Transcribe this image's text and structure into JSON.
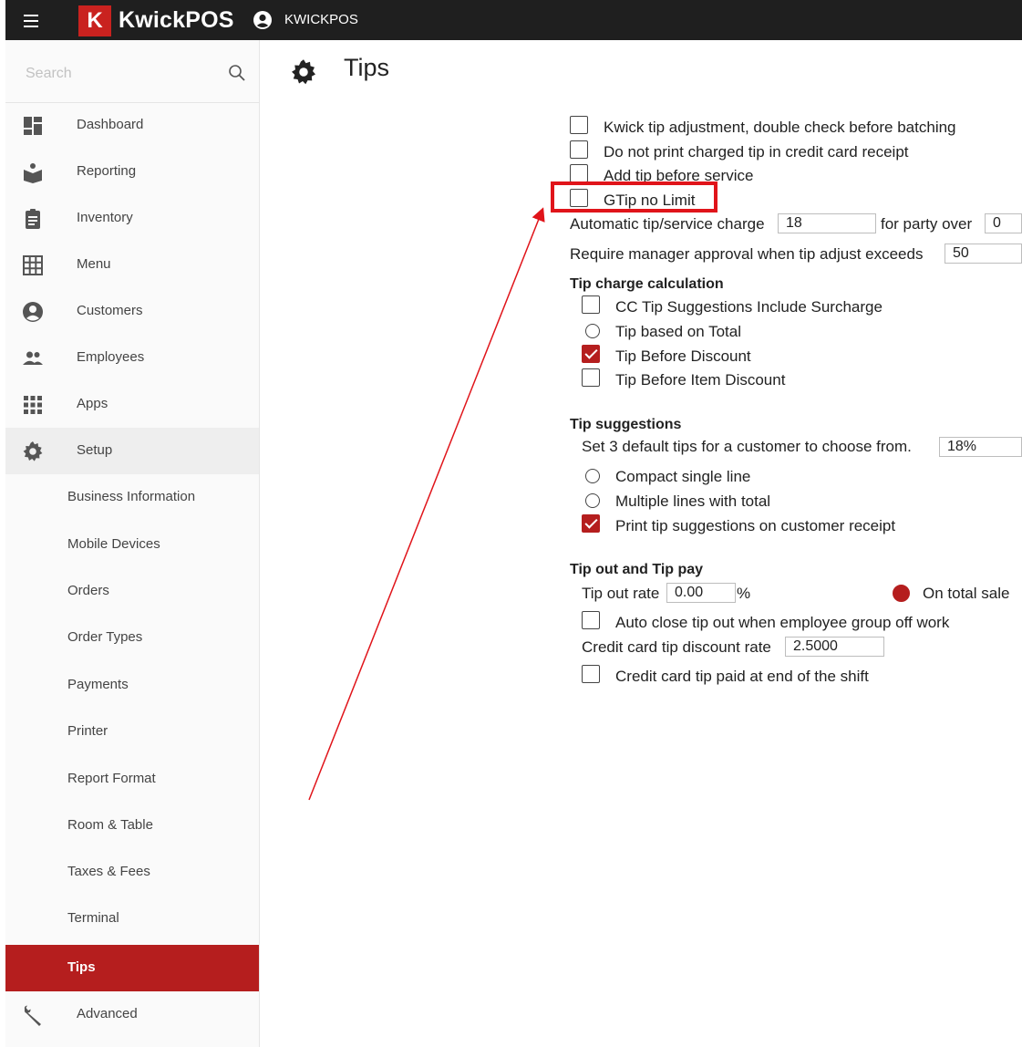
{
  "topbar": {
    "brand": "KwickPOS",
    "logo_letter": "K",
    "user": "KWICKPOS"
  },
  "search": {
    "placeholder": "Search"
  },
  "sidebar": {
    "items": [
      {
        "label": "Dashboard",
        "icon": "dashboard-icon"
      },
      {
        "label": "Reporting",
        "icon": "reporting-icon"
      },
      {
        "label": "Inventory",
        "icon": "inventory-icon"
      },
      {
        "label": "Menu",
        "icon": "menu-grid-icon"
      },
      {
        "label": "Customers",
        "icon": "customer-icon"
      },
      {
        "label": "Employees",
        "icon": "employees-icon"
      },
      {
        "label": "Apps",
        "icon": "apps-icon"
      },
      {
        "label": "Setup",
        "icon": "gear-icon"
      }
    ],
    "setup_children": [
      "Business Information",
      "Mobile Devices",
      "Orders",
      "Order Types",
      "Payments",
      "Printer",
      "Report Format",
      "Room & Table",
      "Taxes & Fees",
      "Terminal",
      "Tips"
    ],
    "advanced": {
      "label": "Advanced",
      "icon": "wrench-icon"
    }
  },
  "page": {
    "title": "Tips"
  },
  "options": {
    "kwick_tip": "Kwick tip adjustment, double check before batching",
    "no_print_tip": "Do not print charged tip in credit card receipt",
    "add_tip_before": "Add tip before service",
    "gtip_no_limit": "GTip no Limit",
    "auto_tip_label": "Automatic tip/service charge",
    "auto_tip_value": "18",
    "party_over_label": "for party over",
    "party_over_value": "0",
    "manager_approval_label": "Require manager approval when tip adjust exceeds",
    "manager_approval_value": "50"
  },
  "tip_charge": {
    "heading": "Tip charge calculation",
    "cc_surcharge": "CC Tip Suggestions Include Surcharge",
    "based_on_total": "Tip based on Total",
    "before_discount": "Tip Before Discount",
    "before_item_discount": "Tip Before Item Discount"
  },
  "tip_suggestions": {
    "heading": "Tip suggestions",
    "default_label": "Set 3 default tips for a customer to choose from.",
    "default_value": "18%",
    "compact": "Compact single line",
    "multiple": "Multiple lines with total",
    "print": "Print tip suggestions on customer receipt"
  },
  "tip_out": {
    "heading": "Tip out and Tip pay",
    "rate_label": "Tip out rate",
    "rate_value": "0.00",
    "percent": "%",
    "on_total_sale": "On total sale",
    "auto_close": "Auto close tip out when employee group off work",
    "cc_discount_label": "Credit card tip discount rate",
    "cc_discount_value": "2.5000",
    "cc_paid_end": "Credit card tip paid at end of the shift"
  },
  "annotation": {
    "highlight_color": "#e0141a"
  }
}
